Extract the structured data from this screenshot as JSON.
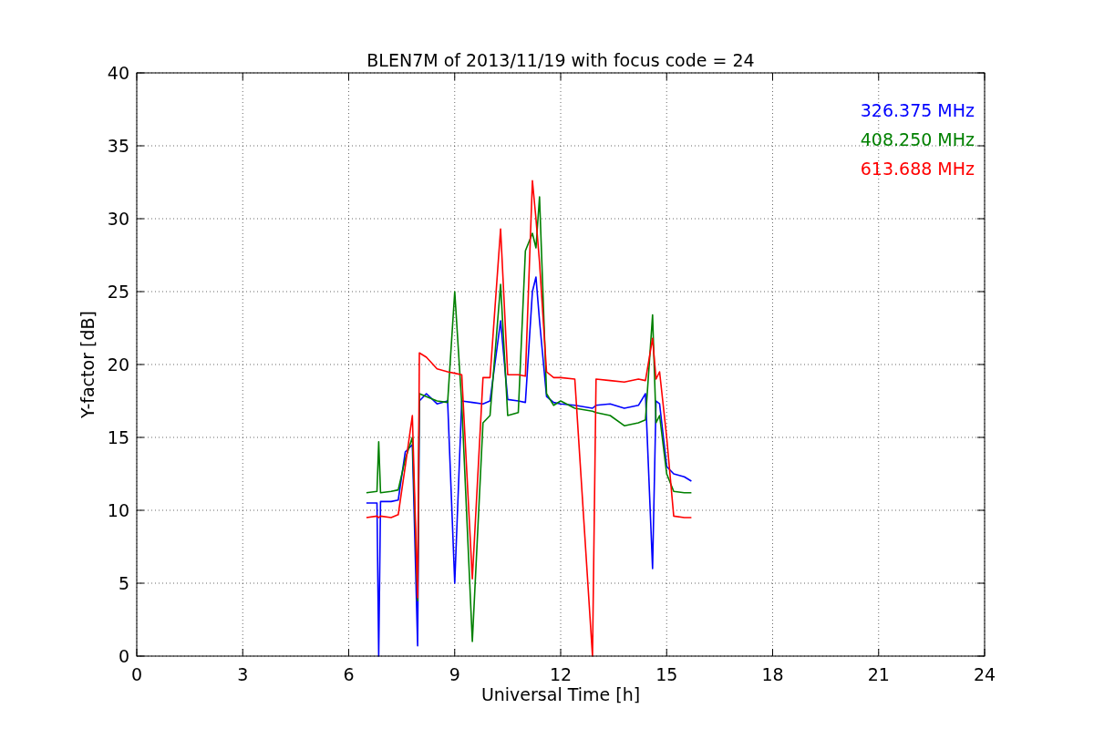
{
  "chart_data": {
    "type": "line",
    "title": "BLEN7M of 2013/11/19 with focus code = 24",
    "xlabel": "Universal Time [h]",
    "ylabel": "Y-factor [dB]",
    "x": [
      6.5,
      6.8,
      6.85,
      6.9,
      7.2,
      7.4,
      7.6,
      7.8,
      7.95,
      8.0,
      8.2,
      8.5,
      8.8,
      9.0,
      9.2,
      9.5,
      9.8,
      10.0,
      10.3,
      10.5,
      10.8,
      11.0,
      11.2,
      11.3,
      11.4,
      11.6,
      11.8,
      12.0,
      12.4,
      12.9,
      13.0,
      13.4,
      13.8,
      14.2,
      14.4,
      14.6,
      14.7,
      14.8,
      15.0,
      15.2,
      15.5,
      15.7
    ],
    "series": [
      {
        "name": "326.375 MHz",
        "color": "#0000ff",
        "values": [
          10.5,
          10.5,
          0,
          10.6,
          10.6,
          10.7,
          14,
          14.5,
          0.7,
          17.5,
          18,
          17.3,
          17.5,
          5,
          17.5,
          17.4,
          17.3,
          17.5,
          23,
          17.6,
          17.5,
          17.4,
          25,
          26,
          23,
          17.8,
          17.4,
          17.3,
          17.2,
          17.0,
          17.2,
          17.3,
          17.0,
          17.2,
          18,
          6,
          17.5,
          17.3,
          13,
          12.5,
          12.3,
          12
        ]
      },
      {
        "name": "408.250 MHz",
        "color": "#008000",
        "values": [
          11.2,
          11.3,
          14.7,
          11.2,
          11.3,
          11.4,
          13.5,
          15,
          3.8,
          18,
          17.8,
          17.5,
          17.4,
          25,
          17.3,
          1.0,
          16,
          16.5,
          25.5,
          16.5,
          16.7,
          27.8,
          29,
          28,
          31.5,
          18,
          17.2,
          17.5,
          17.0,
          16.8,
          16.7,
          16.5,
          15.8,
          16,
          16.2,
          23.4,
          16,
          16.5,
          12.5,
          11.3,
          11.2,
          11.2
        ]
      },
      {
        "name": "613.688 MHz",
        "color": "#ff0000",
        "values": [
          9.5,
          9.6,
          9.5,
          9.6,
          9.5,
          9.7,
          13,
          16.5,
          4,
          20.8,
          20.5,
          19.7,
          19.5,
          19.4,
          19.3,
          5.3,
          19.1,
          19.1,
          29.3,
          19.3,
          19.3,
          19.2,
          32.6,
          30,
          27,
          19.5,
          19.1,
          19.1,
          19.0,
          0,
          19.0,
          18.9,
          18.8,
          19.0,
          18.9,
          21.8,
          19,
          19.5,
          15,
          9.6,
          9.5,
          9.5
        ]
      }
    ],
    "xlim": [
      0,
      24
    ],
    "ylim": [
      0,
      40
    ],
    "grid": true,
    "xticks": [
      0,
      3,
      6,
      9,
      12,
      15,
      18,
      21,
      24
    ],
    "yticks": [
      0,
      5,
      10,
      15,
      20,
      25,
      30,
      35,
      40
    ]
  }
}
